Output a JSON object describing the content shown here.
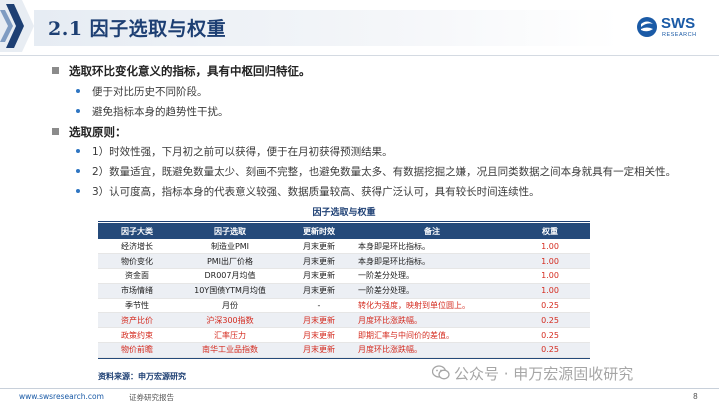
{
  "header": {
    "title": "2.1 因子选取与权重",
    "logo_text": "SWS",
    "logo_sub": "RESEARCH"
  },
  "bullets": [
    {
      "text": "选取环比变化意义的指标，具有中枢回归特征。",
      "subs": [
        "便于对比历史不同阶段。",
        "避免指标本身的趋势性干扰。"
      ]
    },
    {
      "text": "选取原则：",
      "subs": [
        "1）时效性强，下月初之前可以获得，便于在月初获得预测结果。",
        "2）数量适宜，既避免数量太少、刻画不完整，也避免数量太多、有数据挖掘之嫌，况且同类数据之间本身就具有一定相关性。",
        "3）认可度高，指标本身的代表意义较强、数据质量较高、获得广泛认可，具有较长时间连续性。"
      ]
    }
  ],
  "table": {
    "title": "因子选取与权重",
    "headers": [
      "因子大类",
      "因子选取",
      "更新时效",
      "备注",
      "权重"
    ],
    "rows": [
      {
        "c1": "经济增长",
        "c2": "制造业PMI",
        "c3": "月末更新",
        "c4": "本身即是环比指标。",
        "c5": "1.00",
        "red": false
      },
      {
        "c1": "物价变化",
        "c2": "PMI出厂价格",
        "c3": "月末更新",
        "c4": "本身即是环比指标。",
        "c5": "1.00",
        "red": false
      },
      {
        "c1": "资金面",
        "c2": "DR007月均值",
        "c3": "月末更新",
        "c4": "一阶差分处理。",
        "c5": "1.00",
        "red": false
      },
      {
        "c1": "市场情绪",
        "c2": "10Y国债YTM月均值",
        "c3": "月末更新",
        "c4": "一阶差分处理。",
        "c5": "1.00",
        "red": false
      },
      {
        "c1": "季节性",
        "c2": "月份",
        "c3": "-",
        "c4": "转化为强度，映射到单位圆上。",
        "c5": "0.25",
        "red": false,
        "note_red": true
      },
      {
        "c1": "资产比价",
        "c2": "沪深300指数",
        "c3": "月末更新",
        "c4": "月度环比涨跌幅。",
        "c5": "0.25",
        "red": true
      },
      {
        "c1": "政策约束",
        "c2": "汇率压力",
        "c3": "月末更新",
        "c4": "即期汇率与中间价的差值。",
        "c5": "0.25",
        "red": true
      },
      {
        "c1": "物价前瞻",
        "c2": "南华工业品指数",
        "c3": "月末更新",
        "c4": "月度环比涨跌幅。",
        "c5": "0.25",
        "red": true
      }
    ]
  },
  "source": "资料来源：申万宏源研究",
  "footer": {
    "url": "www.swsresearch.com",
    "report": "证券研究报告",
    "page": "8"
  },
  "watermark": "公众号 · 申万宏源固收研究",
  "colors": {
    "navy": "#1d3f73",
    "table_header": "#254a7a",
    "accent_red": "#d42b1f",
    "bullet_blue": "#2e75c2"
  }
}
